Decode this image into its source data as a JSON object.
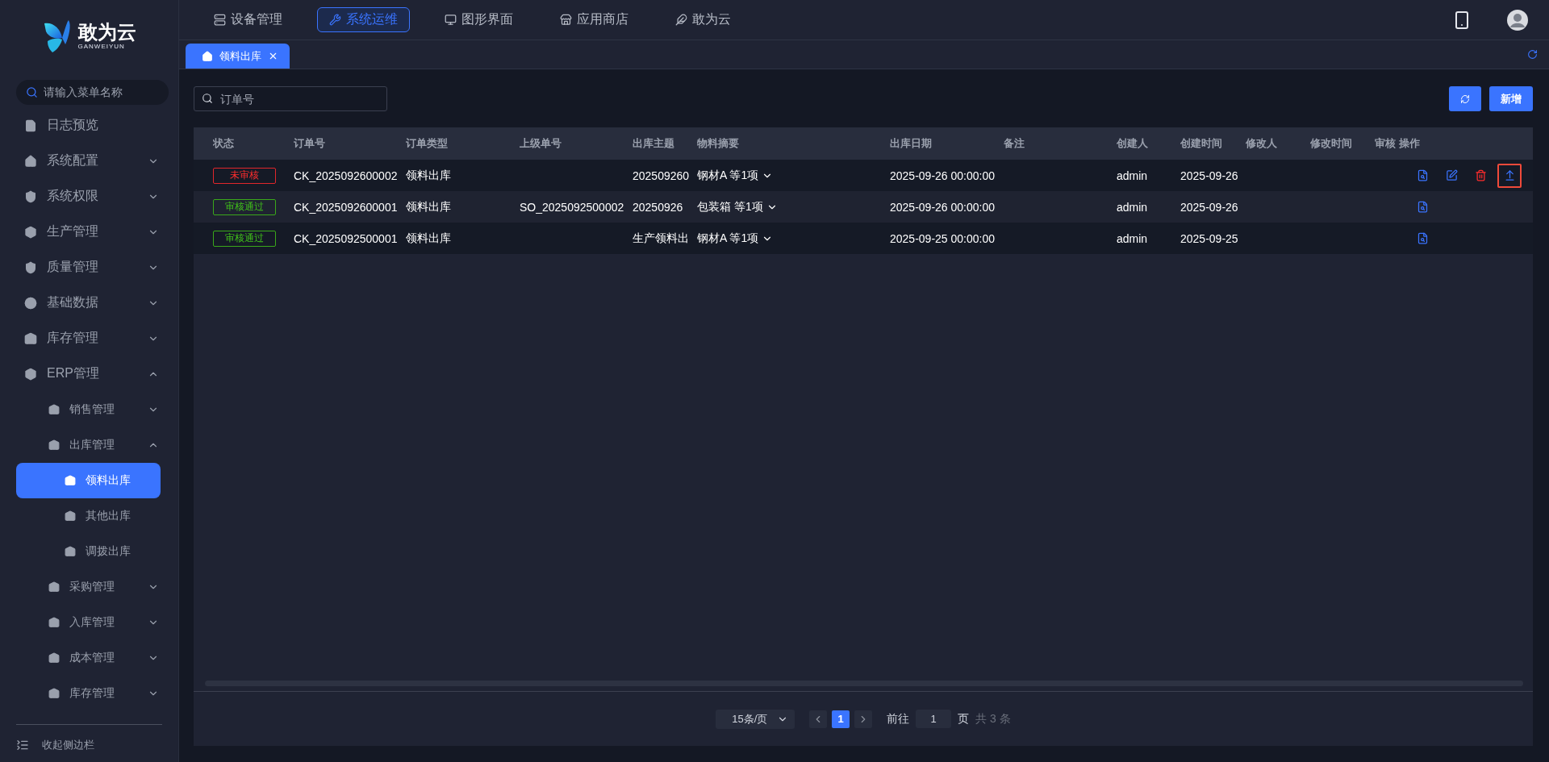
{
  "logo": {
    "name": "敢为云",
    "subtitle": "GANWEIYUN"
  },
  "top_nav": [
    {
      "label": "设备管理",
      "selected": false
    },
    {
      "label": "系统运维",
      "selected": true
    },
    {
      "label": "图形界面",
      "selected": false
    },
    {
      "label": "应用商店",
      "selected": false
    },
    {
      "label": "敢为云",
      "selected": false
    }
  ],
  "page_tabs": [
    {
      "label": "领料出库",
      "selected": true
    }
  ],
  "sidebar": {
    "search": {
      "placeholder": "请输入菜单名称"
    },
    "items": [
      {
        "label": "日志预览",
        "selected": false
      },
      {
        "label": "系统配置",
        "expanded": false,
        "selected": false
      },
      {
        "label": "系统权限",
        "expanded": false,
        "selected": false
      },
      {
        "label": "生产管理",
        "expanded": false,
        "selected": false
      },
      {
        "label": "质量管理",
        "expanded": false,
        "selected": false
      },
      {
        "label": "基础数据",
        "expanded": false,
        "selected": false
      },
      {
        "label": "库存管理",
        "expanded": false,
        "selected": false
      },
      {
        "label": "ERP管理",
        "expanded": true,
        "selected": false,
        "children": [
          {
            "label": "销售管理",
            "expanded": false,
            "selected": false
          },
          {
            "label": "出库管理",
            "expanded": true,
            "selected": false,
            "children": [
              {
                "label": "领料出库",
                "selected": true
              },
              {
                "label": "其他出库",
                "selected": false
              },
              {
                "label": "调拨出库",
                "selected": false
              }
            ]
          },
          {
            "label": "采购管理",
            "expanded": false,
            "selected": false
          },
          {
            "label": "入库管理",
            "expanded": false,
            "selected": false
          },
          {
            "label": "成本管理",
            "expanded": false,
            "selected": false
          },
          {
            "label": "库存管理",
            "expanded": false,
            "selected": false
          }
        ]
      }
    ],
    "collapse": "收起侧边栏"
  },
  "search": {
    "placeholder": "订单号"
  },
  "add_button": "新增",
  "table": {
    "columns": [
      "状态",
      "订单号",
      "订单类型",
      "上级单号",
      "出库主题",
      "物料摘要",
      "出库日期",
      "备注",
      "创建人",
      "创建时间",
      "修改人",
      "修改时间",
      "审核",
      "操作"
    ],
    "rows": [
      {
        "status": {
          "label": "未审核",
          "kind": "pending"
        },
        "order_no": "CK_2025092600002",
        "order_type": "领料出库",
        "parent_no": "",
        "subject": "202509260",
        "materials": "钢材A 等1项",
        "date": "2025-09-26 00:00:00",
        "creator": "admin",
        "created": "2025-09-26",
        "actions": [
          {
            "kind": "view"
          },
          {
            "kind": "edit"
          },
          {
            "kind": "delete"
          },
          {
            "kind": "upload",
            "highlighted": true
          }
        ]
      },
      {
        "status": {
          "label": "审核通过",
          "kind": "approved"
        },
        "order_no": "CK_2025092600001",
        "order_type": "领料出库",
        "parent_no": "SO_2025092500002",
        "subject": "20250926",
        "materials": "包装箱 等1项",
        "date": "2025-09-26 00:00:00",
        "creator": "admin",
        "created": "2025-09-26",
        "actions": [
          {
            "kind": "view"
          }
        ]
      },
      {
        "status": {
          "label": "审核通过",
          "kind": "approved"
        },
        "order_no": "CK_2025092500001",
        "order_type": "领料出库",
        "parent_no": "",
        "subject": "生产领料出",
        "materials": "钢材A 等1项",
        "date": "2025-09-25 00:00:00",
        "creator": "admin",
        "created": "2025-09-25",
        "actions": [
          {
            "kind": "view"
          }
        ]
      }
    ]
  },
  "pagination": {
    "page_size": "15条/页",
    "pages": [
      {
        "label": "1",
        "selected": true
      }
    ],
    "goto_label": "前往",
    "goto_value": "1",
    "page_unit": "页",
    "total": "共 3 条"
  }
}
